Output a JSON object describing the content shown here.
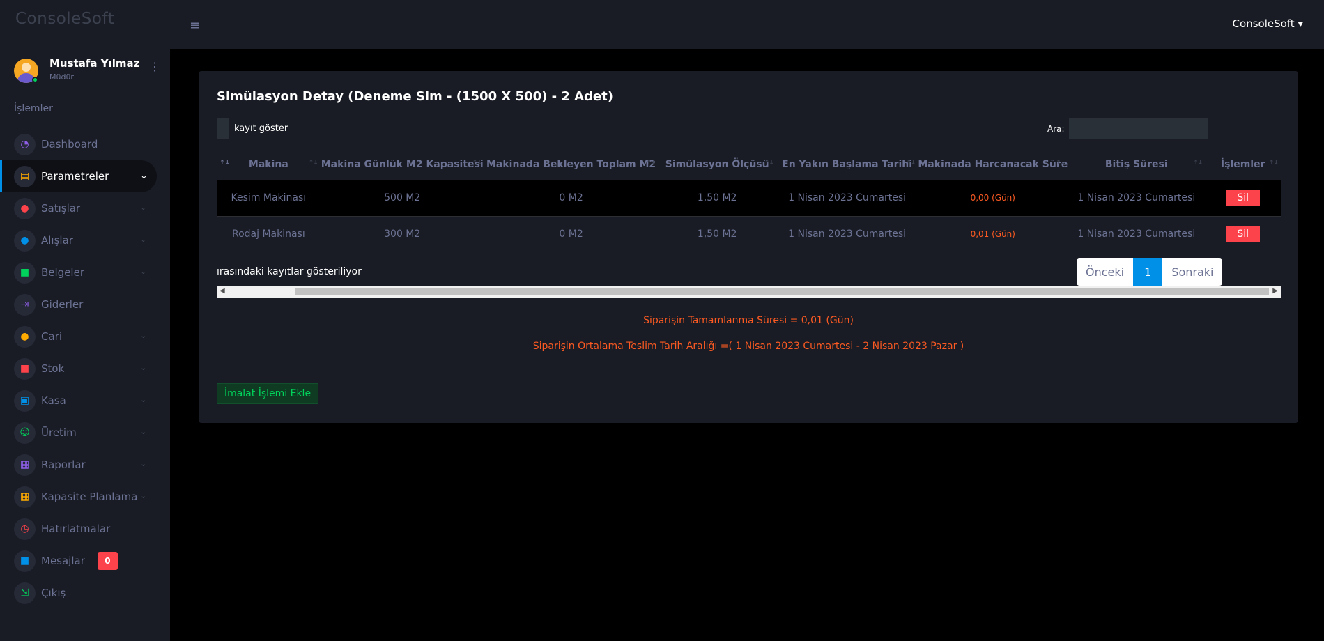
{
  "brand": "ConsoleSoft",
  "profile": {
    "name": "Mustafa Yılmaz",
    "role": "Müdür"
  },
  "section_title": "İşlemler",
  "nav": [
    {
      "label": "Dashboard",
      "icon": "speedometer-icon",
      "color": "#8f5fe8"
    },
    {
      "label": "Parametreler",
      "icon": "layers-icon",
      "color": "#ffab00"
    },
    {
      "label": "Satışlar",
      "icon": "play-circle-icon",
      "color": "#fc424a"
    },
    {
      "label": "Alışlar",
      "icon": "minus-circle-icon",
      "color": "#0090e7"
    },
    {
      "label": "Belgeler",
      "icon": "book-icon",
      "color": "#00d25b"
    },
    {
      "label": "Giderler",
      "icon": "arrow-right-icon",
      "color": "#8f5fe8"
    },
    {
      "label": "Cari",
      "icon": "users-icon",
      "color": "#ffab00"
    },
    {
      "label": "Stok",
      "icon": "box-icon",
      "color": "#fc424a"
    },
    {
      "label": "Kasa",
      "icon": "cash-icon",
      "color": "#0090e7"
    },
    {
      "label": "Üretim",
      "icon": "robot-icon",
      "color": "#00d25b"
    },
    {
      "label": "Raporlar",
      "icon": "clipboard-icon",
      "color": "#8f5fe8"
    },
    {
      "label": "Kapasite Planlama",
      "icon": "clipboard-alert-icon",
      "color": "#ffab00"
    },
    {
      "label": "Hatırlatmalar",
      "icon": "alarm-icon",
      "color": "#fc424a"
    },
    {
      "label": "Mesajlar",
      "icon": "message-icon",
      "color": "#0090e7",
      "badge": "0"
    },
    {
      "label": "Çıkış",
      "icon": "logout-icon",
      "color": "#00d25b"
    }
  ],
  "topbar": {
    "user_menu": "ConsoleSoft ▾"
  },
  "card": {
    "title": "Simülasyon Detay (Deneme Sim - (1500 X 500) - 2 Adet)",
    "length_label": "kayıt göster",
    "search_label": "Ara:",
    "columns": [
      "Makina",
      "Makina Günlük M2 Kapasitesi",
      "Makinada Bekleyen Toplam M2",
      "Simülasyon Ölçüsü",
      "En Yakın Başlama Tarihi",
      "Makinada Harcanacak Süre",
      "Bitiş Süresi",
      "İşlemler"
    ],
    "rows": [
      [
        "Kesim Makinası",
        "500 M2",
        "0 M2",
        "1,50 M2",
        "1 Nisan 2023 Cumartesi",
        "0,00 (Gün)",
        "1 Nisan 2023 Cumartesi",
        "Sil"
      ],
      [
        "Rodaj Makinası",
        "300 M2",
        "0 M2",
        "1,50 M2",
        "1 Nisan 2023 Cumartesi",
        "0,01 (Gün)",
        "1 Nisan 2023 Cumartesi",
        "Sil"
      ]
    ],
    "info": "ırasındaki kayıtlar gösteriliyor",
    "pager": {
      "prev": "Önceki",
      "current": "1",
      "next": "Sonraki"
    },
    "summary_completion": "Siparişin Tamamlanma Süresi = 0,01 (Gün)",
    "summary_delivery": "Siparişin Ortalama Teslim Tarih Aralığı =( 1 Nisan 2023 Cumartesi - 2 Nisan 2023 Pazar )",
    "add_button": "İmalat İşlemi Ekle"
  }
}
